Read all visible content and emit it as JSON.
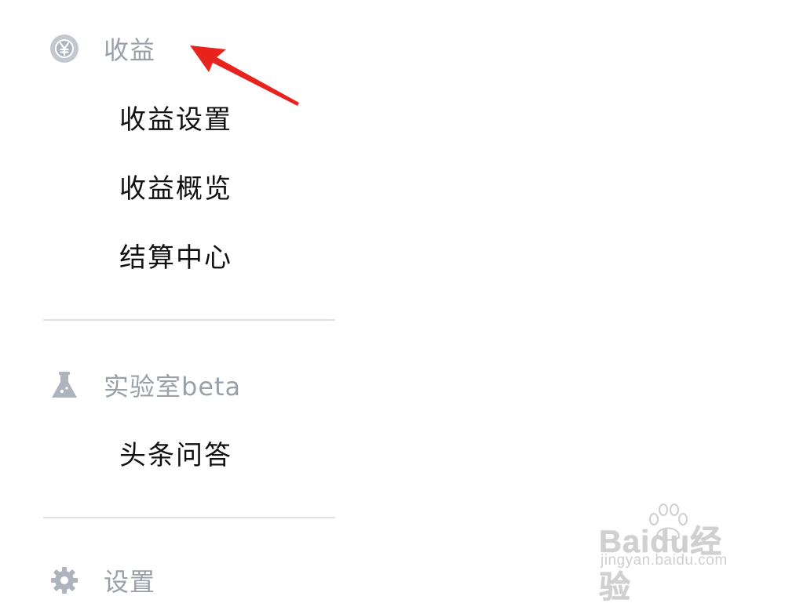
{
  "sections": {
    "earnings": {
      "title": "收益",
      "icon": "yen-coin-icon",
      "items": [
        "收益设置",
        "收益概览",
        "结算中心"
      ]
    },
    "lab": {
      "title": "实验室beta",
      "icon": "flask-icon",
      "items": [
        "头条问答"
      ]
    },
    "settings": {
      "title": "设置",
      "icon": "gear-icon"
    }
  },
  "annotation": {
    "icon": "red-arrow-icon",
    "color": "#e8231e"
  },
  "watermark": {
    "logo": "Baidu经验",
    "url": "jingyan.baidu.com"
  },
  "colors": {
    "section_title": "#9aa0a8",
    "item_text": "#111111",
    "divider": "#dde2ea",
    "icon_gray": "#b5bac3"
  }
}
